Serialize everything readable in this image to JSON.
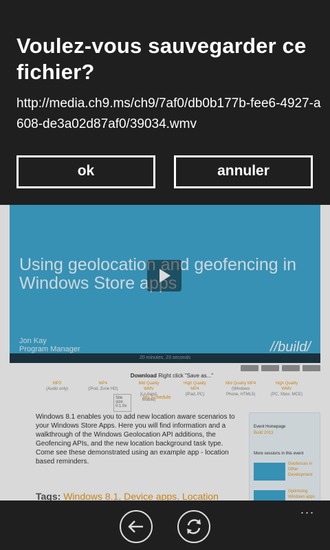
{
  "dialog": {
    "title": "Voulez-vous sauvegarder ce fichier?",
    "url": "http://media.ch9.ms/ch9/7af0/db0b177b-fee6-4927-a608-de3a02d87af0/39034.wmv",
    "ok_label": "ok",
    "cancel_label": "annuler"
  },
  "webpage": {
    "video": {
      "title": "Using geolocation and geofencing in Windows Store apps",
      "speaker_name": "Jon Kay",
      "speaker_role": "Program Manager",
      "logo": "//build/",
      "bar_text": "20 minutes, 23 seconds"
    },
    "download_label": "Download",
    "download_hint": "Right click \"Save as...\"",
    "formats": [
      {
        "name": "MP3",
        "sub": "(Audio only)"
      },
      {
        "name": "MP4",
        "sub": "(iPod, Zune HD)"
      },
      {
        "name": "Mid Quality WMV",
        "sub": "(Lo-band, Mobile)"
      },
      {
        "name": "High Quality MP4",
        "sub": "(iPad, PC)"
      },
      {
        "name": "Mid Quality MP4",
        "sub": "(Windows Phone, HTML5)"
      },
      {
        "name": "High Quality WMV",
        "sub": "(PC, Xbox, MCE)"
      }
    ],
    "site_box": "Site size 0:1.0x",
    "schedule": "My Schedule",
    "description": "Windows 8.1 enables you to add new location aware scenarios to your Windows Store Apps. Here you will find information and a walkthrough of the Windows Geolocation API additions, the Geofencing APIs, and the new location background task type. Come see these demonstrated using an example app - location based reminders.",
    "tags_label": "Tags:",
    "tags": "Windows 8.1, Device apps, Location",
    "sidebar": {
      "event_label": "Event Homepage",
      "event_link": "Build 2013",
      "more_label": "More sessions in this event",
      "links": [
        "Geofences in Other Development",
        "Optimizing Windows apps"
      ]
    }
  },
  "app_bar": {
    "back_icon": "back-arrow-icon",
    "refresh_icon": "refresh-icon",
    "more": "..."
  }
}
